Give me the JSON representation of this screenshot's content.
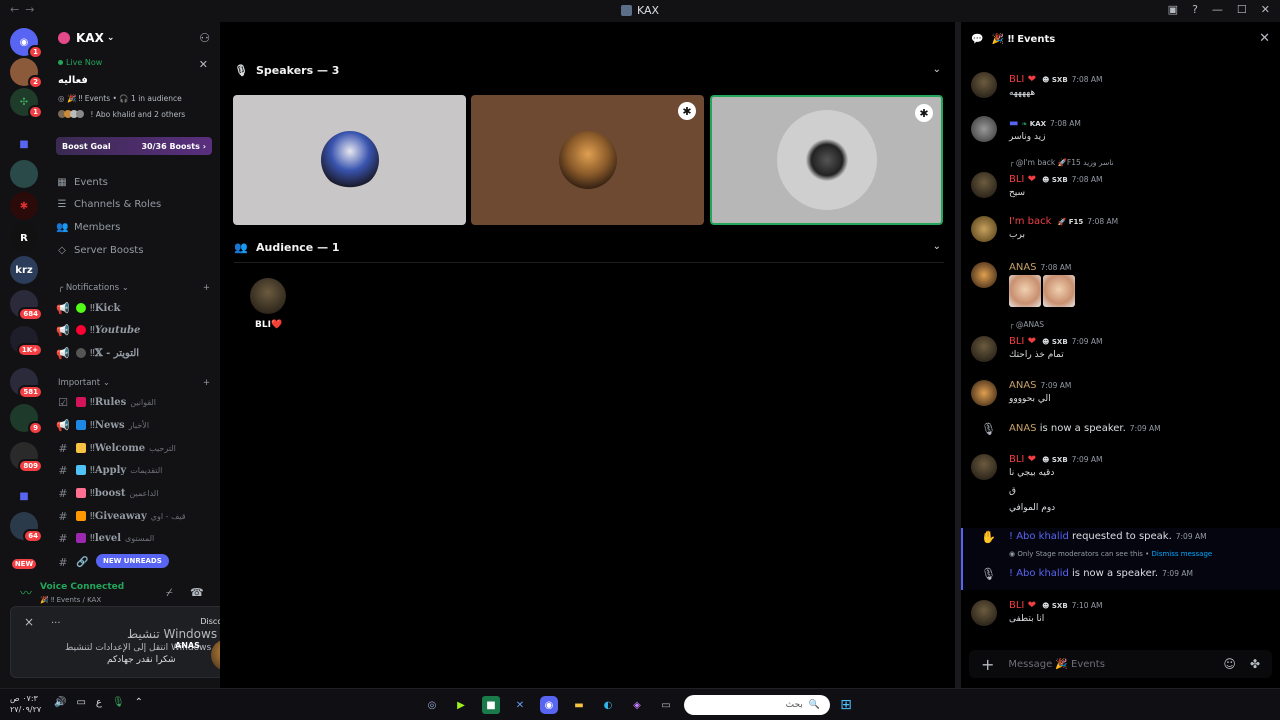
{
  "window": {
    "title": "KAX",
    "back": "←",
    "forward": "→"
  },
  "servers": {
    "badges": [
      "1",
      "2",
      "1",
      "684",
      "1K+",
      "581",
      "9",
      "809",
      "64",
      "NEW"
    ],
    "labels": {
      "krz": "krz",
      "r": "R"
    }
  },
  "guild": {
    "name": "KAX",
    "live": {
      "label": "Live Now",
      "title": "فعاليه",
      "category": "Events",
      "audience": "1 in audience",
      "people": "! Abo khalid and 2 others"
    },
    "boost": {
      "label": "Boost Goal",
      "progress": "30/36 Boosts",
      "progress_fraction": 0.8333
    },
    "menu": [
      "Events",
      "Channels & Roles",
      "Members",
      "Server Boosts"
    ],
    "categories": {
      "notifications": "Notifications",
      "important": "Important"
    },
    "notif_channels": [
      {
        "name": "Kick",
        "color": "#53fc18"
      },
      {
        "name": "Youtube",
        "color": "#ff0033"
      },
      {
        "name": "𝕏 - التويتر",
        "color": "#555555"
      }
    ],
    "important_channels": [
      {
        "name": "Rules",
        "arabic": "القوانين",
        "color": "#d4145a"
      },
      {
        "name": "News",
        "arabic": "الأخبار",
        "color": "#1e88e5"
      },
      {
        "name": "Welcome",
        "arabic": "الترحيب",
        "color": "#f6c343"
      },
      {
        "name": "Apply",
        "arabic": "التقديمات",
        "color": "#4fc3f7"
      },
      {
        "name": "boost",
        "arabic": "الداعمين",
        "color": "#ff6f91"
      },
      {
        "name": "Giveaway",
        "arabic": "قيف - اوي",
        "color": "#ff9800"
      },
      {
        "name": "level",
        "arabic": "المستوى",
        "color": "#9c27b0"
      }
    ],
    "new_unreads": "NEW UNREADS"
  },
  "voice": {
    "status": "Voice Connected",
    "channel": "Events / KAX"
  },
  "toast": {
    "app": "Discord",
    "close": "×",
    "dots": "...",
    "line1": "تنشيط Windows",
    "line2": "انتقل إلى الإعدادات لتنشيط Windows.",
    "line3": "شكرا نقدر جهادكم",
    "sender": "ANAS"
  },
  "stage": {
    "speakers_label": "Speakers — 3",
    "audience_label": "Audience — 1",
    "speakers": [
      {
        "bg": "#c9c6c7",
        "av": "helmet",
        "moderator": false
      },
      {
        "bg": "#6e4a32",
        "av": "warrior",
        "moderator": true
      },
      {
        "bg": "#b7b7b7",
        "av": "hood",
        "moderator": true
      }
    ],
    "audience": [
      {
        "name": "BLI❤️"
      }
    ]
  },
  "chat": {
    "title": "Events",
    "placeholder": "Message 🎉 Events",
    "messages": [
      {
        "name": "BLI",
        "name_color": "#f23f43",
        "tag": "SXB",
        "time": "7:08 AM",
        "body": "هههههه"
      },
      {
        "name": "",
        "name_color": "#dbdee1",
        "tag": "KAX",
        "time": "7:08 AM",
        "body": "زيد وناسر"
      },
      {
        "reply": "@I'm back 🚀F15 ناسر وزيد",
        "name": "BLI",
        "name_color": "#f23f43",
        "tag": "SXB",
        "time": "7:08 AM",
        "body": "سيح"
      },
      {
        "name": "I'm back",
        "name_color": "#f23f43",
        "tag": "F15",
        "time": "7:08 AM",
        "body": "برب"
      },
      {
        "name": "ANAS",
        "name_color": "#c7a26a",
        "tag": "",
        "time": "7:08 AM",
        "body": ""
      },
      {
        "reply": "@ANAS",
        "name": "BLI",
        "name_color": "#f23f43",
        "tag": "SXB",
        "time": "7:09 AM",
        "body": "تمام خذ راحتك"
      },
      {
        "name": "ANAS",
        "name_color": "#c7a26a",
        "tag": "",
        "time": "7:09 AM",
        "body": "الي بحوووو"
      },
      {
        "system": "is now a speaker.",
        "name": "ANAS",
        "time": "7:09 AM"
      },
      {
        "name": "BLI",
        "name_color": "#f23f43",
        "tag": "SXB",
        "time": "7:09 AM",
        "body": "دقيه بيجي نا",
        "body2": "ق",
        "body3": "دوم الموافي"
      },
      {
        "system": "requested to speak.",
        "name": "! Abo khalid",
        "time": "7:09 AM",
        "note": "Only Stage moderators can see this •",
        "note_link": "Dismiss message"
      },
      {
        "system": "is now a speaker.",
        "name": "! Abo khalid",
        "time": "7:09 AM"
      },
      {
        "name": "BLI",
        "name_color": "#f23f43",
        "tag": "SXB",
        "time": "7:10 AM",
        "body": "انا بتطفى"
      }
    ]
  },
  "taskbar": {
    "time": "٠٧:٣ ص",
    "date": "٢٧/٠٩/٢٧",
    "lang": "ع",
    "search_placeholder": "بحث"
  }
}
